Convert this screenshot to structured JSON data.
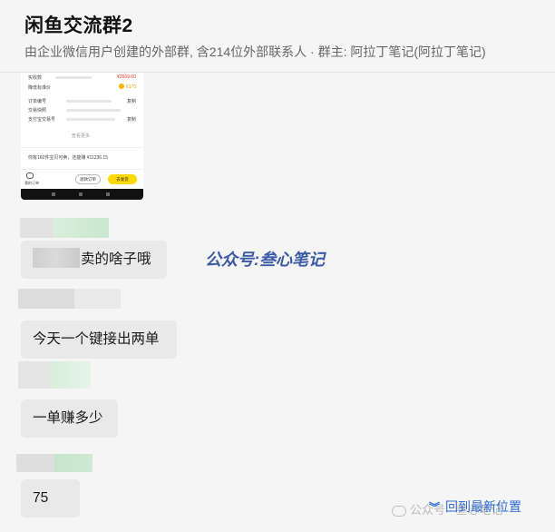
{
  "header": {
    "title": "闲鱼交流群2",
    "subtitle": "由企业微信用户创建的外部群, 含214位外部联系人 · 群主: 阿拉丁笔记(阿拉丁笔记)"
  },
  "screenshot": {
    "rows": [
      {
        "label": "实收款",
        "value": "¥2669.60"
      },
      {
        "label": "降低标准价",
        "value": "6170"
      },
      {
        "label": "订单编号",
        "value": "复制"
      },
      {
        "label": "交易快照",
        "value": ""
      },
      {
        "label": "支付宝交易号",
        "value": "复制"
      }
    ],
    "more": "查看更多",
    "summary": "你有160件宝贝可卖，还能赚 ¥11236.15",
    "footer": {
      "left_label": "我的订单",
      "mid_label": "退款订单",
      "right_label": "去发货"
    }
  },
  "messages": [
    {
      "text": "卖的啥子哦"
    },
    {
      "text": "今天一个键接出两单"
    },
    {
      "text": "一单赚多少"
    },
    {
      "text": "75"
    }
  ],
  "watermark": "公众号:叁心笔记",
  "jump_label": "回到最新位置",
  "wx_watermark": "公众号 · 叁心笔记",
  "colors": {
    "accent": "#2f6bd8",
    "watermark": "#3c5aa6",
    "bubble": "#e9e9e9",
    "background": "#f5f5f5"
  }
}
